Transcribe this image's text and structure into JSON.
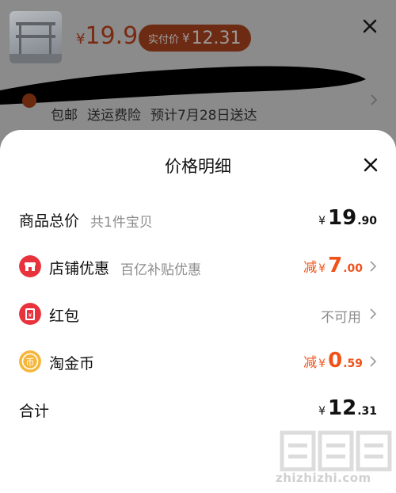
{
  "header": {
    "price_currency": "¥",
    "price_value": "19.9",
    "final_price_label": "实付价",
    "final_price_currency": "¥",
    "final_price_value": "12.31",
    "shipping_items": [
      "包邮",
      "送运费险",
      "预计7月28日送达"
    ],
    "thumb_icon": "product-thumbnail"
  },
  "sheet": {
    "title": "价格明细",
    "rows": [
      {
        "name": "商品总价",
        "sub": "共1件宝贝",
        "prefix": "",
        "currency": "¥",
        "int": "19",
        "dec": ".90",
        "color": "#111111"
      },
      {
        "name": "店铺优惠",
        "sub": "百亿补贴优惠",
        "prefix": "减",
        "currency": "¥",
        "int": "7",
        "dec": ".00",
        "color": "#f0521a",
        "icon": "store-icon",
        "icon_color": "#e8323c"
      },
      {
        "name": "红包",
        "status": "不可用",
        "icon": "red-packet-icon",
        "icon_color": "#e8323c"
      },
      {
        "name": "淘金币",
        "prefix": "减",
        "currency": "¥",
        "int": "0",
        "dec": ".59",
        "color": "#f0521a",
        "icon": "gold-coin-icon",
        "icon_color": "#f5b73b"
      },
      {
        "name": "合计",
        "currency": "¥",
        "int": "12",
        "dec": ".31",
        "color": "#111111"
      }
    ]
  },
  "watermark": {
    "text": "zhizhizhi.com"
  }
}
